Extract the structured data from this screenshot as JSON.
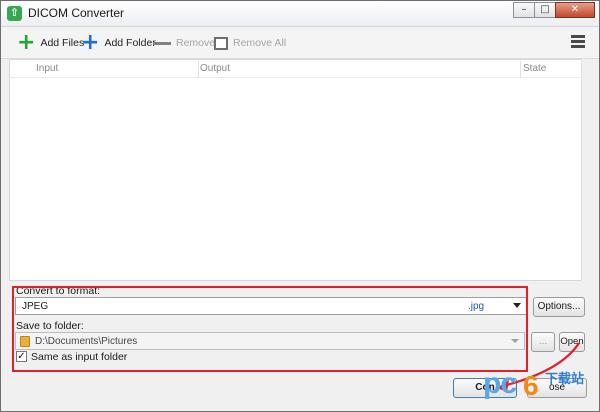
{
  "window": {
    "title": "DICOM Converter",
    "app_icon_glyph": "⇧"
  },
  "window_controls": {
    "minimize": "–",
    "maximize": "□",
    "close": "✕"
  },
  "toolbar": {
    "add_files": "Add Files",
    "add_folder": "Add Folder",
    "remove": "Remove",
    "remove_all": "Remove All",
    "icons": [
      "plus-green-icon",
      "plus-blue-icon",
      "minus-icon",
      "square-icon",
      "hamburger-menu-icon"
    ]
  },
  "file_list": {
    "columns": [
      "Input",
      "Output",
      "State"
    ],
    "rows": []
  },
  "convert": {
    "label": "Convert to format:",
    "format": "JPEG",
    "extension": ".jpg",
    "options_button": "Options..."
  },
  "save": {
    "label": "Save to folder:",
    "path": "D:\\Documents\\Pictures",
    "browse_button": "...",
    "open_button": "Open",
    "same_as_input_label": "Same as input folder",
    "same_as_input_checked": true
  },
  "actions": {
    "convert_button": "Con",
    "close_button": "ose"
  },
  "watermark": {
    "logo": "pc",
    "digit": "6",
    "chinese": "下载站"
  },
  "colors": {
    "accent_green": "#1fa82a",
    "accent_blue": "#1e6fd9",
    "annotation_red": "#e0202c",
    "extension_blue": "#1f55c9"
  }
}
